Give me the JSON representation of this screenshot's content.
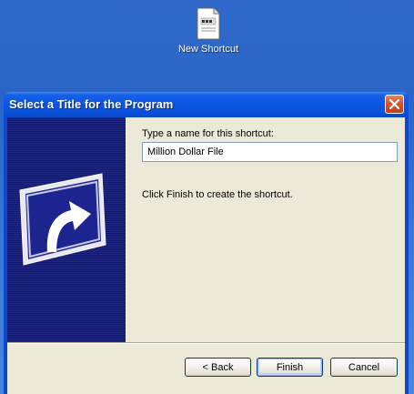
{
  "desktop": {
    "icon": {
      "name": "file-icon",
      "label": "New Shortcut"
    }
  },
  "dialog": {
    "title": "Select a Title for the Program",
    "close_icon": "close-icon",
    "prompt_label": "Type a name for this shortcut:",
    "name_value": "Million Dollar File",
    "info_text": "Click Finish to create the shortcut.",
    "side_art": "shortcut-arrow-icon",
    "buttons": {
      "back": "< Back",
      "finish": "Finish",
      "cancel": "Cancel"
    }
  },
  "colors": {
    "titlebar": "#0a55e3",
    "client": "#ece9d8",
    "side_panel": "#16208a",
    "close_button": "#d9542b"
  }
}
